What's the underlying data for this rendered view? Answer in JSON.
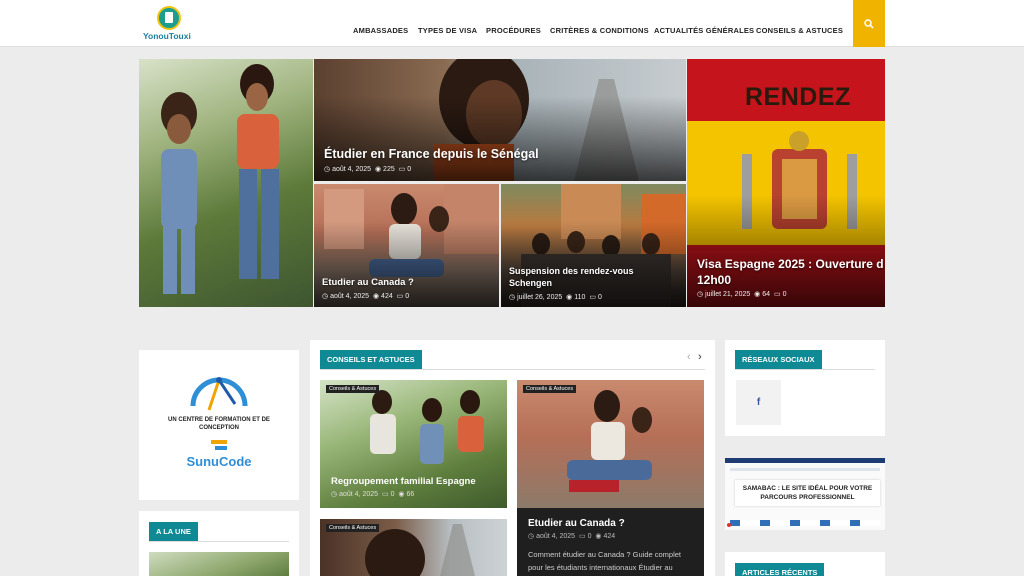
{
  "header": {
    "logo_text": "YonouTouxi",
    "nav": [
      "AMBASSADES",
      "TYPES DE VISA",
      "PROCÉDURES",
      "CRITÈRES & CONDITIONS",
      "ACTUALITÉS GÉNÉRALES",
      "CONSEILS & ASTUCES"
    ]
  },
  "hero": {
    "france": {
      "title": "Étudier en France depuis le Sénégal",
      "date": "août 4, 2025",
      "views": "225",
      "comments": "0"
    },
    "canada": {
      "title": "Etudier au Canada ?",
      "date": "août 4, 2025",
      "views": "424",
      "comments": "0"
    },
    "schengen": {
      "title_line1": "Suspension des rendez-vous",
      "title_line2": "Schengen",
      "date": "juillet 26, 2025",
      "views": "110",
      "comments": "0"
    },
    "espagne": {
      "banner_text": "RENDEZ",
      "title_line1": "Visa Espagne 2025 : Ouverture d",
      "title_line2": "12h00",
      "date": "juillet 21, 2025",
      "views": "64",
      "comments": "0"
    }
  },
  "ad": {
    "line1": "UN CENTRE DE FORMATION ET DE",
    "line2": "CONCEPTION",
    "brand": "SunuCode"
  },
  "a_la_une": {
    "label": "A LA UNE"
  },
  "conseils": {
    "label": "CONSEILS ET ASTUCES",
    "cards": [
      {
        "category": "Conseils & Astuces",
        "title": "Regroupement familial Espagne",
        "date": "août 4, 2025",
        "comments": "0",
        "views": "66"
      },
      {
        "category": "Conseils & Astuces",
        "title": "Etudier au Canada ?",
        "date": "août 4, 2025",
        "comments": "0",
        "views": "424",
        "excerpt_line1": "Comment étudier au Canada ? Guide complet",
        "excerpt_line2": "pour les étudiants internationaux Étudier au"
      },
      {
        "category": "Conseils & Astuces"
      }
    ]
  },
  "social": {
    "label": "RÉSEAUX SOCIAUX",
    "facebook": "f"
  },
  "samabac": {
    "line1": "SAMABAC : LE SITE IDÉAL POUR VOTRE",
    "line2": "PARCOURS PROFESSIONNEL"
  },
  "recent": {
    "label": "ARTICLES RÉCENTS"
  },
  "colors": {
    "accent": "#0f8a95",
    "search": "#f0b400",
    "facebook": "#3b5998"
  },
  "icons": [
    "search-icon",
    "clock-icon",
    "eye-icon",
    "comment-icon",
    "chevron-left-icon",
    "chevron-right-icon",
    "facebook-icon"
  ]
}
